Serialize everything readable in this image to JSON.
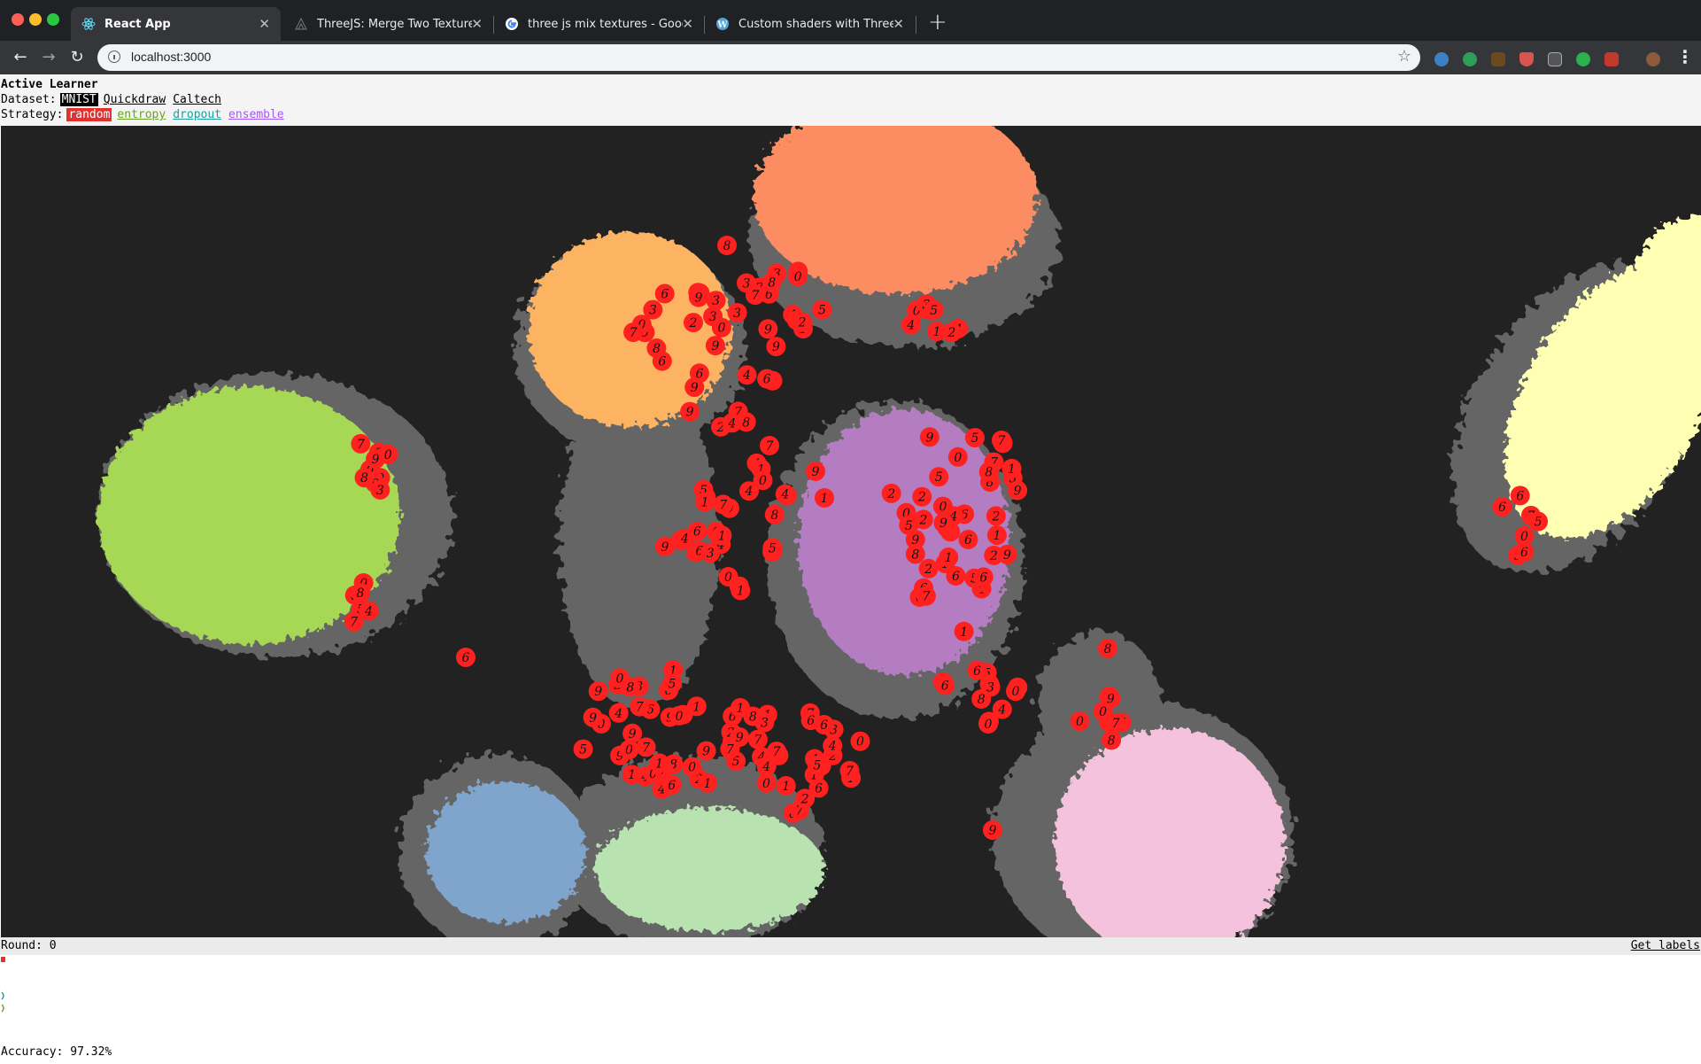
{
  "browser": {
    "tabs": [
      {
        "title": "React App",
        "active": true,
        "icon": "react-icon"
      },
      {
        "title": "ThreeJS: Merge Two Textures",
        "active": false,
        "icon": "threejs-icon"
      },
      {
        "title": "three js mix textures - Google S",
        "active": false,
        "icon": "google-icon"
      },
      {
        "title": "Custom shaders with Three.JS",
        "active": false,
        "icon": "wordpress-icon"
      }
    ],
    "address": "localhost:3000",
    "extensions": [
      "extension-icon-1",
      "extension-icon-2",
      "extension-icon-3",
      "extension-icon-4",
      "extension-icon-5",
      "extension-icon-6",
      "extension-icon-7"
    ]
  },
  "app": {
    "title": "Active Learner",
    "dataset": {
      "label": "Dataset:",
      "options": [
        "MNIST",
        "Quickdraw",
        "Caltech"
      ],
      "selected": "MNIST"
    },
    "strategy": {
      "label": "Strategy:",
      "options": [
        "random",
        "entropy",
        "dropout",
        "ensemble"
      ],
      "selected": "random"
    },
    "round_label": "Round: 0",
    "get_labels": "Get labels",
    "accuracy_label": "Accuracy: 97.32%"
  },
  "colors": {
    "selected_points": "#ff2020",
    "random": "#e3312f",
    "entropy": "#66a61e",
    "dropout": "#1b9e9e",
    "ensemble": "#a855f7",
    "canvas_bg": "#222222",
    "unlabeled": "#6b6b6b"
  }
}
